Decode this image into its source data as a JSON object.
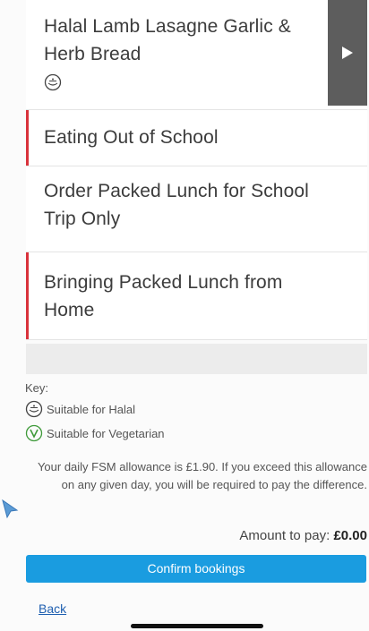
{
  "menu_items": [
    {
      "title": "Halal Lamb Lasagne Garlic & Herb Bread",
      "badge_icon": "halal-icon"
    },
    {
      "title": "Eating Out of School"
    },
    {
      "title": "Order Packed Lunch for School Trip Only"
    },
    {
      "title": "Bringing Packed Lunch from Home"
    }
  ],
  "key": {
    "label": "Key:",
    "halal": "Suitable for Halal",
    "vegetarian": "Suitable for Vegetarian"
  },
  "allowance_text": "Your daily FSM allowance is £1.90. If you exceed this allowance on any given day, you will be required to pay the difference.",
  "amount": {
    "label": "Amount to pay:",
    "value": "£0.00"
  },
  "confirm_label": "Confirm bookings",
  "back_label": "Back",
  "colors": {
    "accent_red": "#d9323b",
    "button_blue": "#1a9ce0",
    "link_blue": "#1f5fb0",
    "arrow_panel": "#5d5d5d"
  }
}
